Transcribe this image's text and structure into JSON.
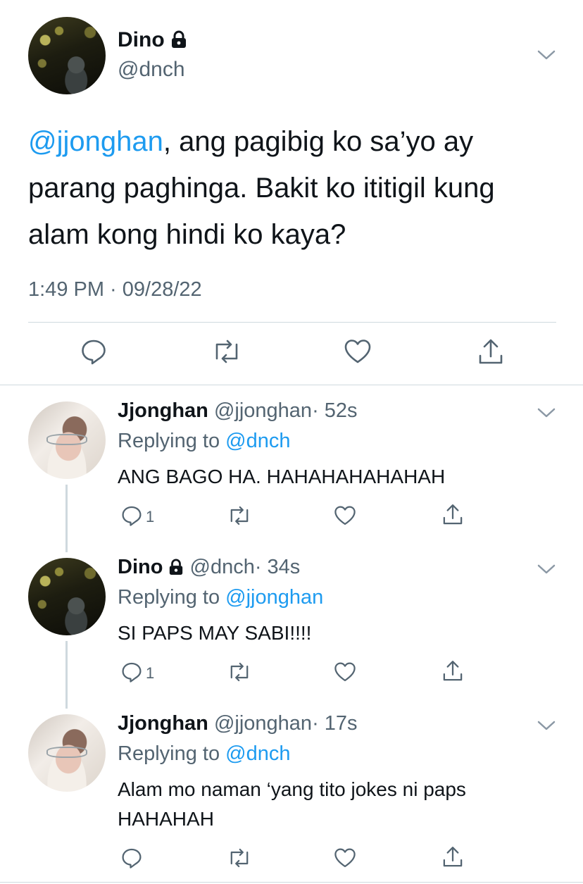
{
  "main_tweet": {
    "display_name": "Dino",
    "handle": "@dnch",
    "mention": "@jjonghan",
    "text_after_mention": ", ang pagibig ko sa’yo ay parang paghinga. Bakit ko ititigil kung alam kong hindi ko kaya?",
    "timestamp": "1:49 PM · 09/28/22"
  },
  "replies": [
    {
      "display_name": "Jjonghan",
      "handle": "@jjonghan",
      "time": "· 52s",
      "replying_prefix": "Replying to",
      "replying_to": "@dnch",
      "text": "ANG BAGO HA. HAHAHAHAHAHAH",
      "reply_count": "1"
    },
    {
      "display_name": "Dino",
      "handle": "@dnch",
      "time": "· 34s",
      "replying_prefix": "Replying to",
      "replying_to": "@jjonghan",
      "text": "SI PAPS MAY SABI!!!!",
      "reply_count": "1"
    },
    {
      "display_name": "Jjonghan",
      "handle": "@jjonghan",
      "time": "· 17s",
      "replying_prefix": "Replying to",
      "replying_to": "@dnch",
      "text": "Alam mo naman ‘yang tito jokes ni paps HAHAHAH",
      "reply_count": ""
    }
  ],
  "icons": {
    "reply": "reply-icon",
    "retweet": "retweet-icon",
    "like": "heart-icon",
    "share": "share-icon",
    "lock": "lock-icon",
    "more": "chevron-down-icon"
  },
  "colors": {
    "link": "#1d9bf0",
    "muted": "#536471",
    "text": "#0f1419",
    "divider": "#cfd9de"
  }
}
